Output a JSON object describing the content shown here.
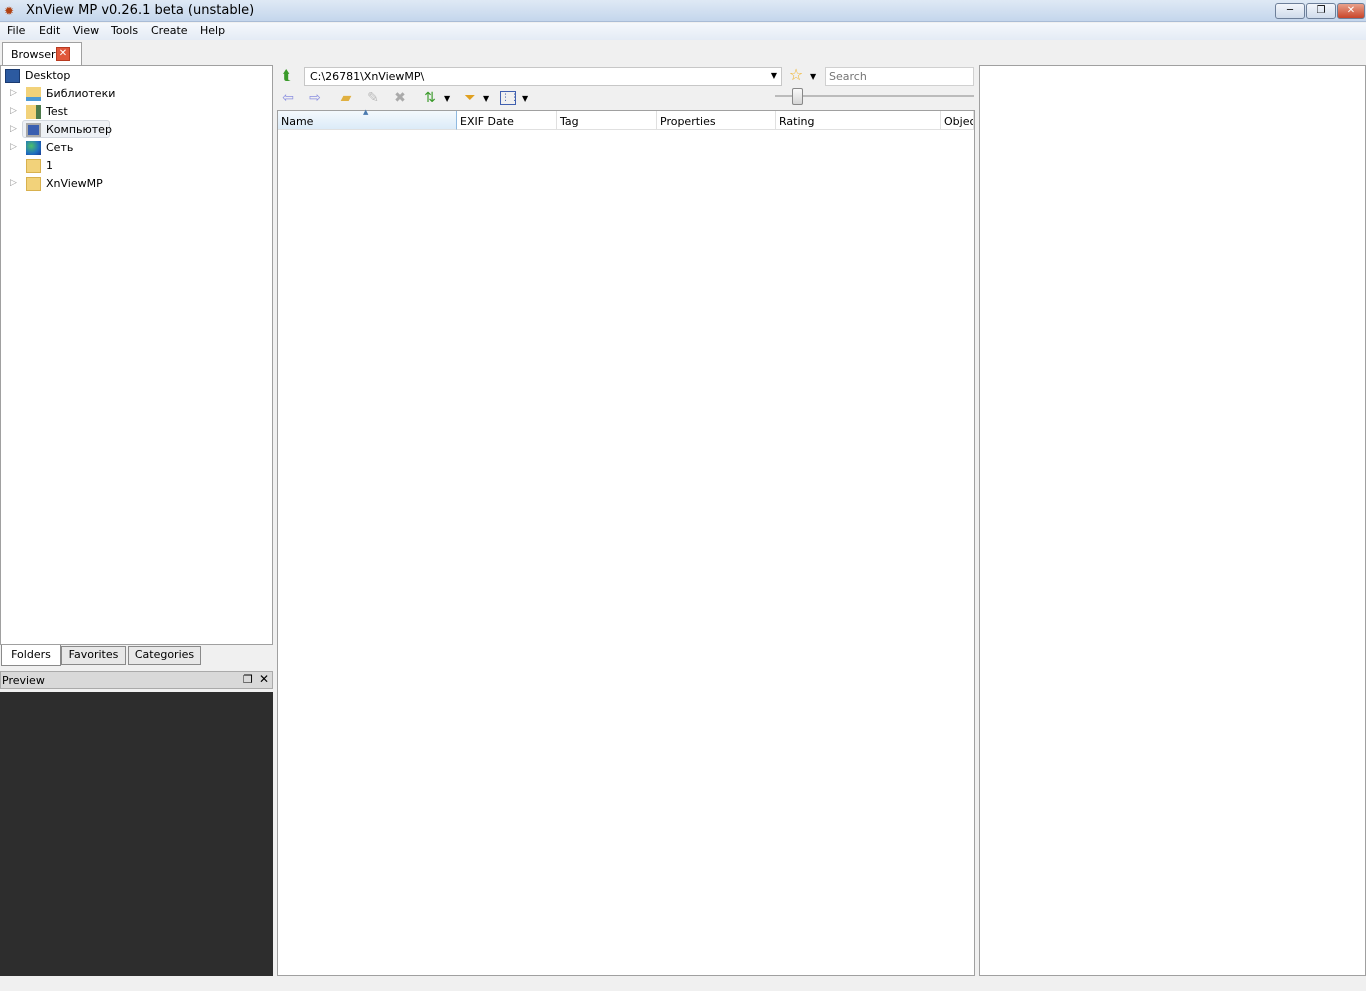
{
  "window": {
    "title": "XnView MP v0.26.1 beta (unstable)",
    "minimize": "─",
    "restore": "❐",
    "close": "✕"
  },
  "menu": [
    "File",
    "Edit",
    "View",
    "Tools",
    "Create",
    "Help"
  ],
  "tabs": {
    "browser": "Browser"
  },
  "tree": [
    {
      "label": "Desktop",
      "icon": "desktop-icon"
    },
    {
      "label": "Библиотеки",
      "icon": "libraries-icon"
    },
    {
      "label": "Test",
      "icon": "user-folder-icon"
    },
    {
      "label": "Компьютер",
      "icon": "computer-icon"
    },
    {
      "label": "Сеть",
      "icon": "network-icon"
    },
    {
      "label": "1",
      "icon": "folder-icon"
    },
    {
      "label": "XnViewMP",
      "icon": "folder-icon"
    }
  ],
  "panel_tabs": [
    "Folders",
    "Favorites",
    "Categories"
  ],
  "preview": {
    "title": "Preview"
  },
  "address": {
    "path": "C:\\26781\\XnViewMP\\",
    "search_placeholder": "Search"
  },
  "columns": [
    "Name",
    "EXIF Date",
    "Tag",
    "Properties",
    "Rating",
    "Objec"
  ]
}
